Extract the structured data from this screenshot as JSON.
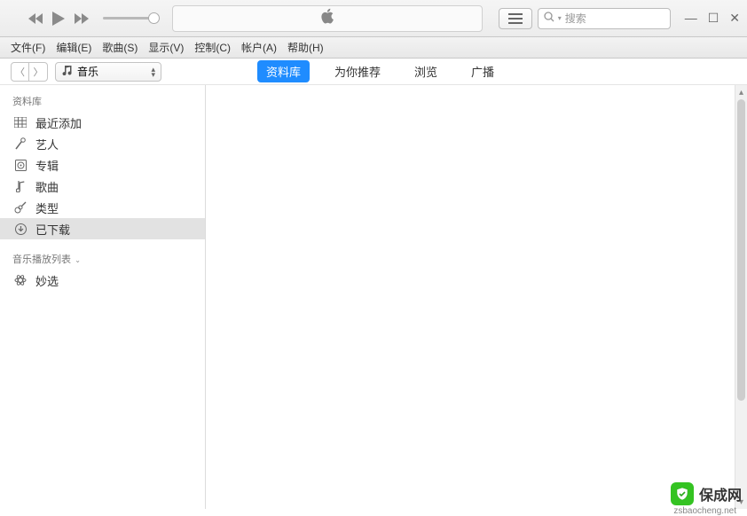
{
  "toolbar": {
    "search_placeholder": "搜索"
  },
  "menubar": {
    "items": [
      "文件(F)",
      "编辑(E)",
      "歌曲(S)",
      "显示(V)",
      "控制(C)",
      "帐户(A)",
      "帮助(H)"
    ]
  },
  "media_select": {
    "label": "音乐"
  },
  "tabs": [
    {
      "label": "资料库",
      "active": true
    },
    {
      "label": "为你推荐",
      "active": false
    },
    {
      "label": "浏览",
      "active": false
    },
    {
      "label": "广播",
      "active": false
    }
  ],
  "sidebar": {
    "section1_header": "资料库",
    "items": [
      {
        "icon": "grid",
        "label": "最近添加",
        "selected": false
      },
      {
        "icon": "mic",
        "label": "艺人",
        "selected": false
      },
      {
        "icon": "album",
        "label": "专辑",
        "selected": false
      },
      {
        "icon": "note",
        "label": "歌曲",
        "selected": false
      },
      {
        "icon": "guitar",
        "label": "类型",
        "selected": false
      },
      {
        "icon": "download",
        "label": "已下载",
        "selected": true
      }
    ],
    "section2_header": "音乐播放列表",
    "playlist_items": [
      {
        "icon": "atom",
        "label": "妙选"
      }
    ]
  },
  "watermark": {
    "text": "保成网",
    "sub": "zsbaocheng.net"
  }
}
